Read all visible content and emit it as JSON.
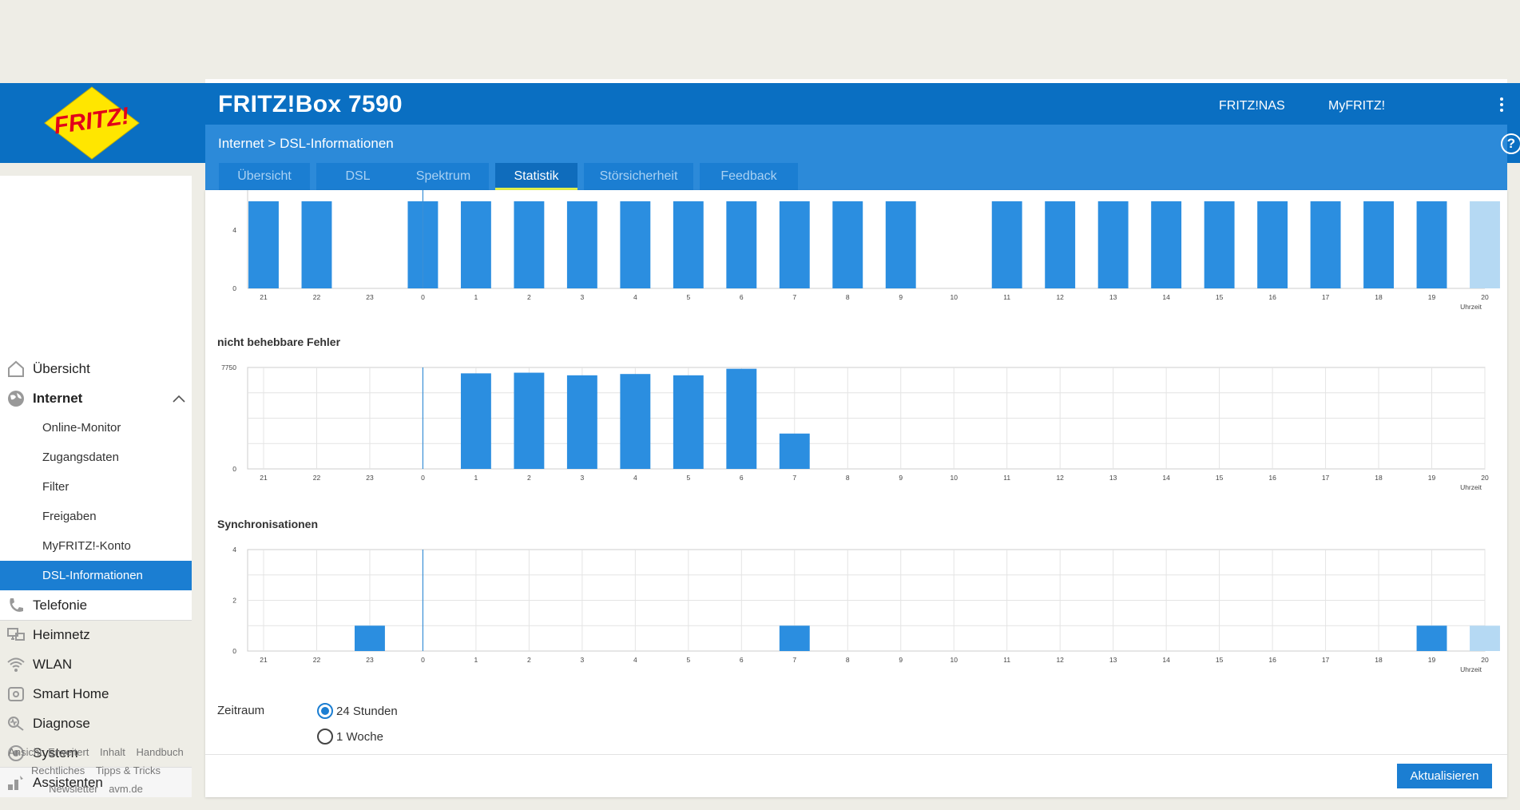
{
  "header": {
    "product": "FRITZ!Box 7590",
    "links": [
      "FRITZ!NAS",
      "MyFRITZ!"
    ],
    "logo_text": "FRITZ!"
  },
  "breadcrumb": {
    "section": "Internet",
    "separator": ">",
    "page": "DSL-Informationen"
  },
  "tabs": [
    {
      "label": "Übersicht",
      "active": false
    },
    {
      "label": "DSL",
      "active": false
    },
    {
      "label": "Spektrum",
      "active": false
    },
    {
      "label": "Statistik",
      "active": true
    },
    {
      "label": "Störsicherheit",
      "active": false
    },
    {
      "label": "Feedback",
      "active": false
    }
  ],
  "sidebar": {
    "items": [
      {
        "label": "Übersicht",
        "icon": "home-icon"
      },
      {
        "label": "Internet",
        "icon": "globe-icon",
        "expanded": true
      },
      {
        "label": "Telefonie",
        "icon": "phone-icon"
      },
      {
        "label": "Heimnetz",
        "icon": "network-icon"
      },
      {
        "label": "WLAN",
        "icon": "wifi-icon"
      },
      {
        "label": "Smart Home",
        "icon": "smart-home-icon"
      },
      {
        "label": "Diagnose",
        "icon": "diagnose-icon"
      },
      {
        "label": "System",
        "icon": "system-icon"
      },
      {
        "label": "Assistenten",
        "icon": "wizard-icon"
      }
    ],
    "internet_subitems": [
      {
        "label": "Online-Monitor",
        "active": false
      },
      {
        "label": "Zugangsdaten",
        "active": false
      },
      {
        "label": "Filter",
        "active": false
      },
      {
        "label": "Freigaben",
        "active": false
      },
      {
        "label": "MyFRITZ!-Konto",
        "active": false
      },
      {
        "label": "DSL-Informationen",
        "active": true
      }
    ]
  },
  "footer": {
    "links": [
      "Ansicht: Erweitert",
      "Inhalt",
      "Handbuch",
      "Rechtliches",
      "Tipps & Tricks",
      "Newsletter",
      "avm.de"
    ]
  },
  "colors": {
    "accent": "#1b7ed2",
    "header": "#0a6fc2",
    "bar": "#2b8ee0",
    "bar_current": "#b5d9f3",
    "active_tab_underline": "#e2f04b"
  },
  "chart_data": [
    {
      "type": "bar",
      "title": "",
      "categories": [
        "21",
        "22",
        "23",
        "0",
        "1",
        "2",
        "3",
        "4",
        "5",
        "6",
        "7",
        "8",
        "9",
        "10",
        "11",
        "12",
        "13",
        "14",
        "15",
        "16",
        "17",
        "18",
        "19",
        "20"
      ],
      "values": [
        6,
        6,
        0,
        6,
        6,
        6,
        6,
        6,
        6,
        6,
        6,
        6,
        6,
        0,
        6,
        6,
        6,
        6,
        6,
        6,
        6,
        6,
        6,
        6
      ],
      "current_hour_index": 23,
      "yticks": [
        0,
        4
      ],
      "ylim": [
        0,
        6.75
      ],
      "xlabel": "Uhrzeit",
      "marker_category": "0",
      "partial_top": true
    },
    {
      "type": "bar",
      "title": "nicht behebbare Fehler",
      "categories": [
        "21",
        "22",
        "23",
        "0",
        "1",
        "2",
        "3",
        "4",
        "5",
        "6",
        "7",
        "8",
        "9",
        "10",
        "11",
        "12",
        "13",
        "14",
        "15",
        "16",
        "17",
        "18",
        "19",
        "20"
      ],
      "values": [
        0,
        0,
        0,
        0,
        7300,
        7350,
        7150,
        7250,
        7150,
        7650,
        2700,
        0,
        0,
        0,
        0,
        0,
        0,
        0,
        0,
        0,
        0,
        0,
        0,
        0
      ],
      "current_hour_index": 23,
      "yticks": [
        0,
        7750
      ],
      "ylim": [
        0,
        7750
      ],
      "xlabel": "Uhrzeit",
      "marker_category": "0"
    },
    {
      "type": "bar",
      "title": "Synchronisationen",
      "categories": [
        "21",
        "22",
        "23",
        "0",
        "1",
        "2",
        "3",
        "4",
        "5",
        "6",
        "7",
        "8",
        "9",
        "10",
        "11",
        "12",
        "13",
        "14",
        "15",
        "16",
        "17",
        "18",
        "19",
        "20"
      ],
      "values": [
        0,
        0,
        1,
        0,
        0,
        0,
        0,
        0,
        0,
        0,
        1,
        0,
        0,
        0,
        0,
        0,
        0,
        0,
        0,
        0,
        0,
        0,
        1,
        1
      ],
      "current_hour_index": 23,
      "yticks": [
        0,
        2,
        4
      ],
      "ylim": [
        0,
        4
      ],
      "xlabel": "Uhrzeit",
      "marker_category": "0"
    }
  ],
  "period": {
    "label": "Zeitraum",
    "options": [
      {
        "label": "24 Stunden",
        "checked": true
      },
      {
        "label": "1 Woche",
        "checked": false
      }
    ]
  },
  "actions": {
    "refresh_label": "Aktualisieren"
  }
}
